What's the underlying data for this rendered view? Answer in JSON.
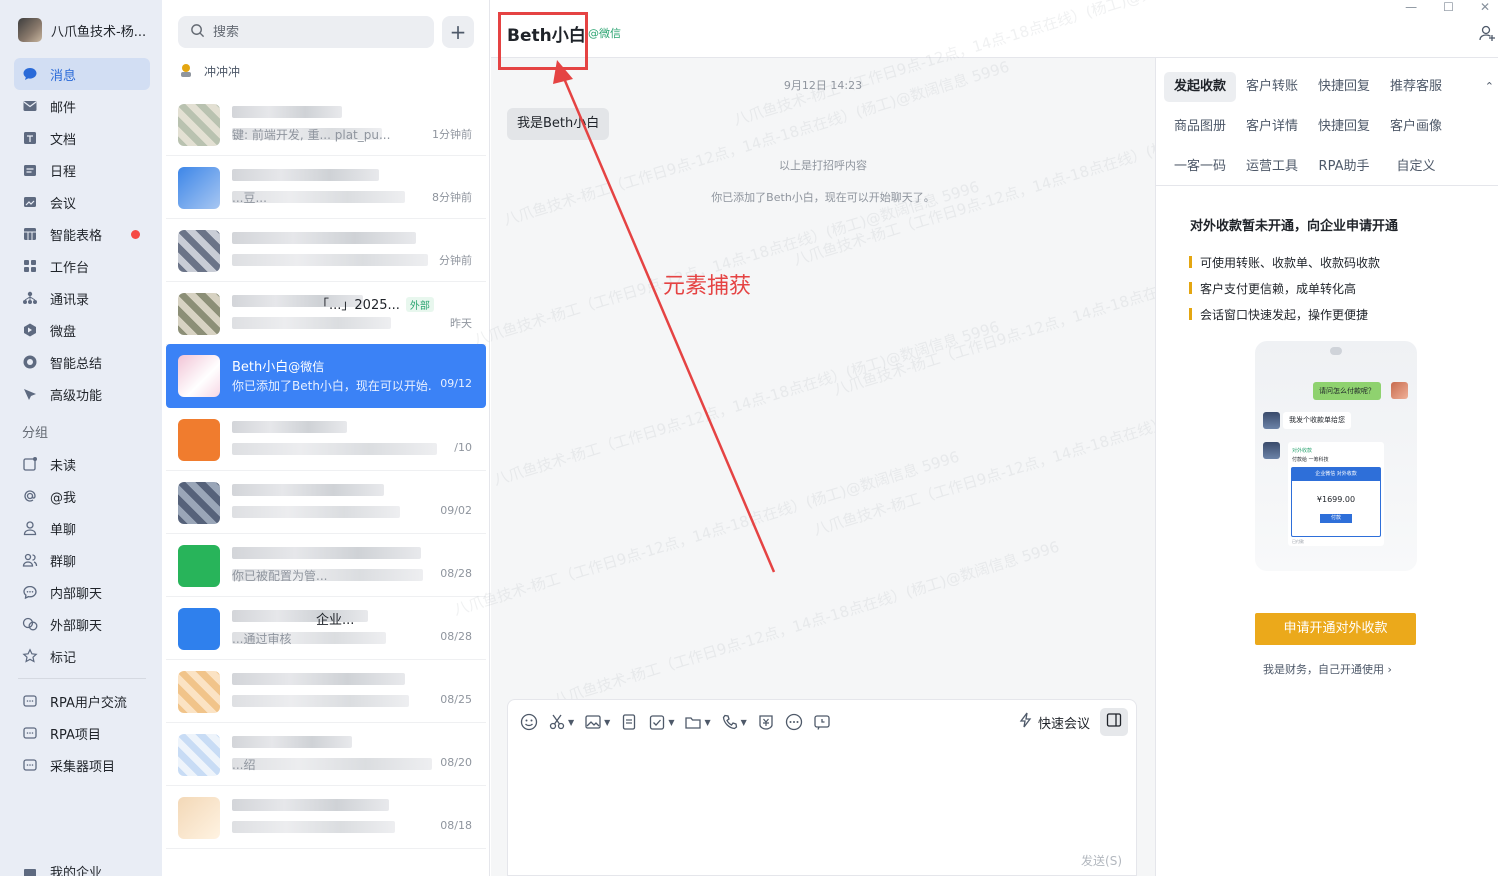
{
  "profile": {
    "name": "八爪鱼技术-杨..."
  },
  "nav": {
    "items": [
      {
        "label": "消息",
        "icon": "chat-bubble-icon",
        "active": true
      },
      {
        "label": "邮件",
        "icon": "mail-icon"
      },
      {
        "label": "文档",
        "icon": "doc-icon"
      },
      {
        "label": "日程",
        "icon": "calendar-icon"
      },
      {
        "label": "会议",
        "icon": "meeting-icon"
      },
      {
        "label": "智能表格",
        "icon": "table-icon",
        "dot": true
      },
      {
        "label": "工作台",
        "icon": "grid-icon"
      },
      {
        "label": "通讯录",
        "icon": "contacts-icon"
      },
      {
        "label": "微盘",
        "icon": "drive-icon"
      },
      {
        "label": "智能总结",
        "icon": "summary-icon"
      },
      {
        "label": "高级功能",
        "icon": "advanced-icon"
      }
    ],
    "group_title": "分组",
    "groups": [
      {
        "label": "未读",
        "icon": "unread-icon"
      },
      {
        "label": "@我",
        "icon": "at-icon"
      },
      {
        "label": "单聊",
        "icon": "person-icon"
      },
      {
        "label": "群聊",
        "icon": "group-icon"
      },
      {
        "label": "内部聊天",
        "icon": "internal-chat-icon"
      },
      {
        "label": "外部聊天",
        "icon": "external-chat-icon"
      },
      {
        "label": "标记",
        "icon": "star-icon"
      }
    ],
    "projects": [
      {
        "label": "RPA用户交流",
        "icon": "folder-chat-icon"
      },
      {
        "label": "RPA项目",
        "icon": "folder-chat-icon"
      },
      {
        "label": "采集器项目",
        "icon": "folder-chat-icon"
      }
    ],
    "my_company": "我的企业"
  },
  "conv_list": {
    "search_placeholder": "搜索",
    "pinned": "冲冲冲",
    "conversations": [
      {
        "name": "",
        "preview": "键: 前端开发, 重... plat_pu...",
        "time": "1分钟前"
      },
      {
        "name": "",
        "preview": "...豆...",
        "time": "8分钟前"
      },
      {
        "name": "",
        "preview": "",
        "time": "分钟前"
      },
      {
        "name": "「...」2025...",
        "tag": "外部",
        "preview": "",
        "time": "昨天"
      },
      {
        "name": "Beth小白",
        "tag": "@微信",
        "preview": "你已添加了Beth小白，现在可以开始...",
        "time": "09/12",
        "active": true
      },
      {
        "name": "",
        "preview": "",
        "time": "/10"
      },
      {
        "name": "",
        "preview": "",
        "time": "09/02"
      },
      {
        "name": "",
        "preview": "你已被配置为管...",
        "time": "08/28"
      },
      {
        "name": "企业...",
        "preview": "...通过审核",
        "time": "08/28"
      },
      {
        "name": "",
        "preview": "",
        "time": "08/25"
      },
      {
        "name": "",
        "preview": "...绍",
        "time": "08/20"
      },
      {
        "name": "",
        "preview": "",
        "time": "08/18"
      }
    ]
  },
  "chat": {
    "title": "Beth小白",
    "title_tag": "@微信",
    "time": "9月12日 14:23",
    "bubble": "我是Beth小白",
    "sys1": "以上是打招呼内容",
    "sys2": "你已添加了Beth小白，现在可以开始聊天了。",
    "annotation": "元素捕获",
    "quick_meet": "快速会议",
    "send": "发送(S)",
    "watermarks": [
      "八爪鱼技术-杨工（工作日9点-12点，14点-18点在线）(杨工)@数阔信息 5996"
    ]
  },
  "right_panel": {
    "tabs": [
      [
        "发起收款",
        "客户转账",
        "快捷回复",
        "推荐客服"
      ],
      [
        "商品图册",
        "客户详情",
        "快捷回复",
        "客户画像"
      ],
      [
        "一客一码",
        "运营工具",
        "RPA助手",
        "自定义"
      ]
    ],
    "title": "对外收款暂未开通，向企业申请开通",
    "features": [
      "可使用转账、收款单、收款码收款",
      "客户支付更信赖，成单转化高",
      "会话窗口快速发起，操作更便捷"
    ],
    "phone": {
      "question": "请问怎么付款呢？",
      "answer": "我发个收款单给您",
      "card_top": "对外收款",
      "card_sub": "付款给 一筹科技",
      "card_band": "企业微信 对外收款",
      "price": "¥1699.00",
      "pay": "付款",
      "foot": "已付款"
    },
    "apply_button": "申请开通对外收款",
    "self_link": "我是财务，自己开通使用 ›"
  },
  "colors": {
    "accent": "#3b82f6",
    "annotation": "#e54343",
    "apply": "#eba91b",
    "wechat_green": "#2ba471"
  }
}
